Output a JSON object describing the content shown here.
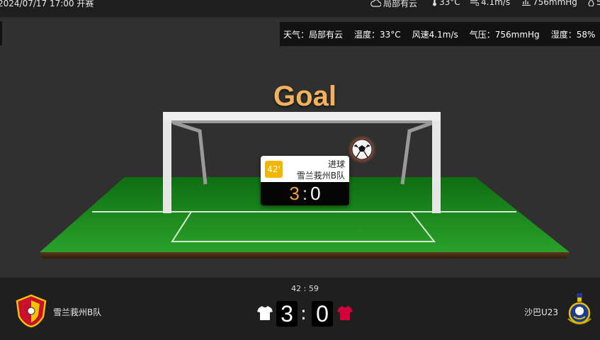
{
  "header": {
    "datetime": "2024/07/17 17:00 开赛",
    "weather_icon": "cloud-icon",
    "weather_short": "局部有云",
    "temp_short": "33°C",
    "wind_short": "4.1m/s",
    "pressure_short": "756mmHg",
    "humidity_short": "5"
  },
  "weather_panel": {
    "weather": "天气：局部有云",
    "temperature": "温度：33°C",
    "wind": "风速4.1m/s",
    "pressure": "气压：756mmHg",
    "humidity": "湿度：58%"
  },
  "animation": {
    "title": "Goal",
    "event": {
      "minute": "42'",
      "type": "进球",
      "team": "雪兰莪州B队",
      "score_home": "3",
      "score_away": "0"
    }
  },
  "match": {
    "home_team": "雪兰莪州B队",
    "away_team": "沙巴U23",
    "clock": "42 : 59",
    "home_score": "3",
    "away_score": "0",
    "home_shirt_color": "#ffffff",
    "away_shirt_color": "#d4003a"
  },
  "colors": {
    "accent": "#f2b15d",
    "minute_badge": "#f2b600",
    "pitch": "#1f8a1a"
  }
}
